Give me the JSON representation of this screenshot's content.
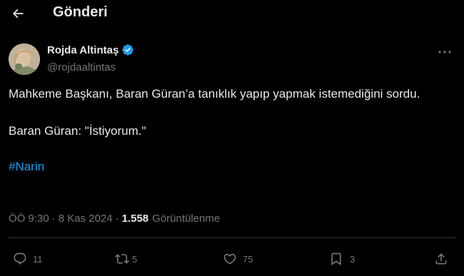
{
  "header": {
    "title": "Gönderi"
  },
  "author": {
    "name": "Rojda Altintaş",
    "handle": "@rojdaaltintas",
    "verified": true
  },
  "tweet": {
    "paragraph1": "Mahkeme Başkanı, Baran Güran’a tanıklık yapıp yapmak istemediğini sordu.",
    "paragraph2": "Baran Güran: \"İstiyorum.\"",
    "hashtag": "#Narin"
  },
  "meta": {
    "time": "ÖÖ 9:30",
    "separator1": "·",
    "date": "8 Kas 2024",
    "separator2": "·",
    "views_count": "1.558",
    "views_label": "Görüntülenme"
  },
  "actions": {
    "replies": "11",
    "reposts": "5",
    "likes": "75",
    "bookmarks": "3"
  },
  "colors": {
    "background": "#000000",
    "text": "#e7e9ea",
    "secondary": "#71767b",
    "accent": "#1d9bf0",
    "border": "#2f3336"
  },
  "icons": [
    "back-arrow-icon",
    "verified-badge-icon",
    "more-icon",
    "reply-icon",
    "repost-icon",
    "like-icon",
    "bookmark-icon",
    "share-icon"
  ]
}
